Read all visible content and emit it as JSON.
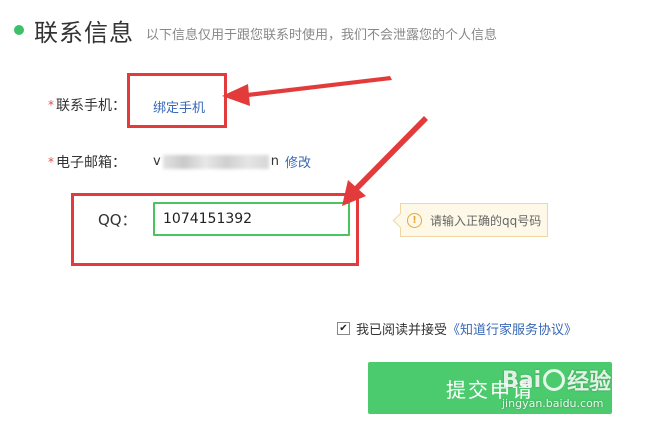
{
  "header": {
    "title": "联系信息",
    "subtitle": "以下信息仅用于跟您联系时使用，我们不会泄露您的个人信息"
  },
  "form": {
    "required_mark": "*",
    "phone": {
      "label": "联系手机：",
      "bind_link": "绑定手机"
    },
    "email": {
      "label": "电子邮箱：",
      "value_start": "v",
      "value_end": "n",
      "edit_link": "修改"
    },
    "qq": {
      "label": "QQ：",
      "value": "1074151392"
    },
    "tooltip": {
      "icon": "warning-icon",
      "text": "请输入正确的qq号码"
    }
  },
  "agreement": {
    "checked": true,
    "check_mark": "✔",
    "text": "我已阅读并接受",
    "link": "《知道行家服务协议》"
  },
  "submit": {
    "label": "提交申请"
  },
  "watermark": {
    "top_left": "Bai",
    "top_right": "经验",
    "bottom": "jingyan.baidu.com"
  },
  "colors": {
    "accent_green": "#4ccb6e",
    "link_blue": "#3868b8",
    "annotation_red": "#e33b3b",
    "required_red": "#e34d4d"
  }
}
